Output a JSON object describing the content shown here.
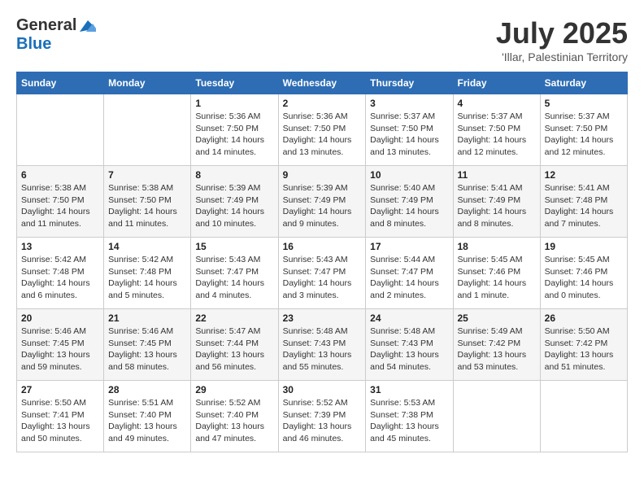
{
  "header": {
    "logo_general": "General",
    "logo_blue": "Blue",
    "month_year": "July 2025",
    "location": "'Illar, Palestinian Territory"
  },
  "weekdays": [
    "Sunday",
    "Monday",
    "Tuesday",
    "Wednesday",
    "Thursday",
    "Friday",
    "Saturday"
  ],
  "rows": [
    [
      {
        "day": "",
        "info": ""
      },
      {
        "day": "",
        "info": ""
      },
      {
        "day": "1",
        "info": "Sunrise: 5:36 AM\nSunset: 7:50 PM\nDaylight: 14 hours and 14 minutes."
      },
      {
        "day": "2",
        "info": "Sunrise: 5:36 AM\nSunset: 7:50 PM\nDaylight: 14 hours and 13 minutes."
      },
      {
        "day": "3",
        "info": "Sunrise: 5:37 AM\nSunset: 7:50 PM\nDaylight: 14 hours and 13 minutes."
      },
      {
        "day": "4",
        "info": "Sunrise: 5:37 AM\nSunset: 7:50 PM\nDaylight: 14 hours and 12 minutes."
      },
      {
        "day": "5",
        "info": "Sunrise: 5:37 AM\nSunset: 7:50 PM\nDaylight: 14 hours and 12 minutes."
      }
    ],
    [
      {
        "day": "6",
        "info": "Sunrise: 5:38 AM\nSunset: 7:50 PM\nDaylight: 14 hours and 11 minutes."
      },
      {
        "day": "7",
        "info": "Sunrise: 5:38 AM\nSunset: 7:50 PM\nDaylight: 14 hours and 11 minutes."
      },
      {
        "day": "8",
        "info": "Sunrise: 5:39 AM\nSunset: 7:49 PM\nDaylight: 14 hours and 10 minutes."
      },
      {
        "day": "9",
        "info": "Sunrise: 5:39 AM\nSunset: 7:49 PM\nDaylight: 14 hours and 9 minutes."
      },
      {
        "day": "10",
        "info": "Sunrise: 5:40 AM\nSunset: 7:49 PM\nDaylight: 14 hours and 8 minutes."
      },
      {
        "day": "11",
        "info": "Sunrise: 5:41 AM\nSunset: 7:49 PM\nDaylight: 14 hours and 8 minutes."
      },
      {
        "day": "12",
        "info": "Sunrise: 5:41 AM\nSunset: 7:48 PM\nDaylight: 14 hours and 7 minutes."
      }
    ],
    [
      {
        "day": "13",
        "info": "Sunrise: 5:42 AM\nSunset: 7:48 PM\nDaylight: 14 hours and 6 minutes."
      },
      {
        "day": "14",
        "info": "Sunrise: 5:42 AM\nSunset: 7:48 PM\nDaylight: 14 hours and 5 minutes."
      },
      {
        "day": "15",
        "info": "Sunrise: 5:43 AM\nSunset: 7:47 PM\nDaylight: 14 hours and 4 minutes."
      },
      {
        "day": "16",
        "info": "Sunrise: 5:43 AM\nSunset: 7:47 PM\nDaylight: 14 hours and 3 minutes."
      },
      {
        "day": "17",
        "info": "Sunrise: 5:44 AM\nSunset: 7:47 PM\nDaylight: 14 hours and 2 minutes."
      },
      {
        "day": "18",
        "info": "Sunrise: 5:45 AM\nSunset: 7:46 PM\nDaylight: 14 hours and 1 minute."
      },
      {
        "day": "19",
        "info": "Sunrise: 5:45 AM\nSunset: 7:46 PM\nDaylight: 14 hours and 0 minutes."
      }
    ],
    [
      {
        "day": "20",
        "info": "Sunrise: 5:46 AM\nSunset: 7:45 PM\nDaylight: 13 hours and 59 minutes."
      },
      {
        "day": "21",
        "info": "Sunrise: 5:46 AM\nSunset: 7:45 PM\nDaylight: 13 hours and 58 minutes."
      },
      {
        "day": "22",
        "info": "Sunrise: 5:47 AM\nSunset: 7:44 PM\nDaylight: 13 hours and 56 minutes."
      },
      {
        "day": "23",
        "info": "Sunrise: 5:48 AM\nSunset: 7:43 PM\nDaylight: 13 hours and 55 minutes."
      },
      {
        "day": "24",
        "info": "Sunrise: 5:48 AM\nSunset: 7:43 PM\nDaylight: 13 hours and 54 minutes."
      },
      {
        "day": "25",
        "info": "Sunrise: 5:49 AM\nSunset: 7:42 PM\nDaylight: 13 hours and 53 minutes."
      },
      {
        "day": "26",
        "info": "Sunrise: 5:50 AM\nSunset: 7:42 PM\nDaylight: 13 hours and 51 minutes."
      }
    ],
    [
      {
        "day": "27",
        "info": "Sunrise: 5:50 AM\nSunset: 7:41 PM\nDaylight: 13 hours and 50 minutes."
      },
      {
        "day": "28",
        "info": "Sunrise: 5:51 AM\nSunset: 7:40 PM\nDaylight: 13 hours and 49 minutes."
      },
      {
        "day": "29",
        "info": "Sunrise: 5:52 AM\nSunset: 7:40 PM\nDaylight: 13 hours and 47 minutes."
      },
      {
        "day": "30",
        "info": "Sunrise: 5:52 AM\nSunset: 7:39 PM\nDaylight: 13 hours and 46 minutes."
      },
      {
        "day": "31",
        "info": "Sunrise: 5:53 AM\nSunset: 7:38 PM\nDaylight: 13 hours and 45 minutes."
      },
      {
        "day": "",
        "info": ""
      },
      {
        "day": "",
        "info": ""
      }
    ]
  ]
}
